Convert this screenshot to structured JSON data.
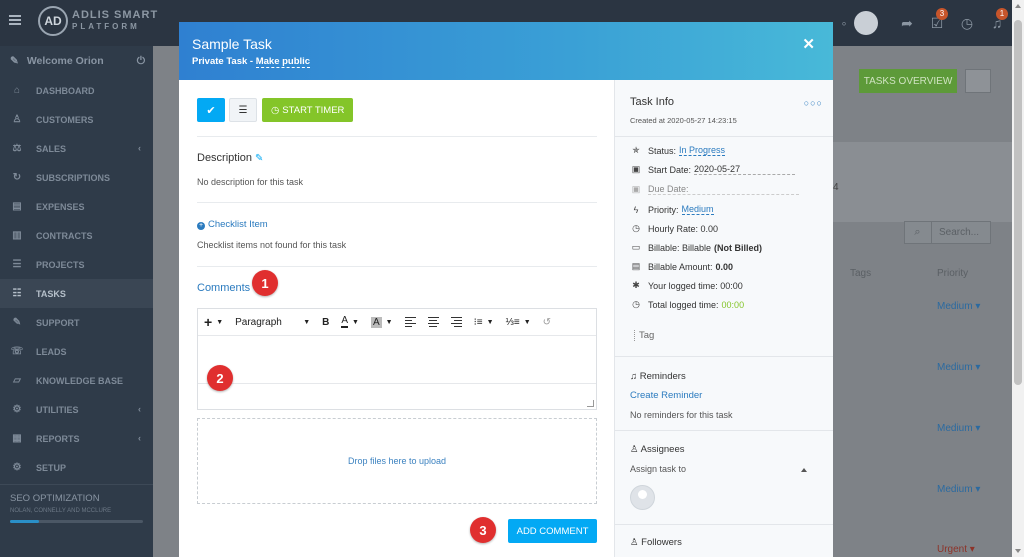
{
  "app": {
    "logo_mark": "AD",
    "logo_line1": "ADLIS SMART",
    "logo_line2": "PLATFORM",
    "badges": {
      "tasks": "3",
      "notifications": "1"
    }
  },
  "sidebar": {
    "welcome": "Welcome Orion",
    "items": [
      {
        "label": "DASHBOARD",
        "icon": "home-icon",
        "glyph": "⌂"
      },
      {
        "label": "CUSTOMERS",
        "icon": "user-icon",
        "glyph": "♙"
      },
      {
        "label": "SALES",
        "icon": "balance-icon",
        "glyph": "⚖",
        "chevron": true
      },
      {
        "label": "SUBSCRIPTIONS",
        "icon": "refresh-icon",
        "glyph": "↻"
      },
      {
        "label": "EXPENSES",
        "icon": "file-icon",
        "glyph": "▤"
      },
      {
        "label": "CONTRACTS",
        "icon": "document-icon",
        "glyph": "▥"
      },
      {
        "label": "PROJECTS",
        "icon": "bars-icon",
        "glyph": "☰"
      },
      {
        "label": "TASKS",
        "icon": "tasks-icon",
        "glyph": "☷",
        "active": true
      },
      {
        "label": "SUPPORT",
        "icon": "ticket-icon",
        "glyph": "✎"
      },
      {
        "label": "LEADS",
        "icon": "tty-icon",
        "glyph": "☏"
      },
      {
        "label": "KNOWLEDGE BASE",
        "icon": "folder-icon",
        "glyph": "▱"
      },
      {
        "label": "UTILITIES",
        "icon": "cogs-icon",
        "glyph": "⚙",
        "chevron": true
      },
      {
        "label": "REPORTS",
        "icon": "chart-icon",
        "glyph": "▦",
        "chevron": true
      },
      {
        "label": "SETUP",
        "icon": "gear-icon",
        "glyph": "⚙"
      }
    ],
    "project": {
      "name": "SEO OPTIMIZATION",
      "client": "NOLAN, CONNELLY AND MCCLURE",
      "progress": 0.22
    }
  },
  "background": {
    "tasks_overview": "TASKS OVERVIEW",
    "search_placeholder": "Search...",
    "col_tags": "Tags",
    "col_priority": "Priority",
    "priorities": [
      "Medium",
      "Medium",
      "Medium",
      "Medium"
    ],
    "last_priority": "Urgent",
    "partial_number": "4"
  },
  "modal": {
    "title": "Sample Task",
    "subtitle_prefix": "Private Task - ",
    "make_public": "Make public",
    "start_timer": "START TIMER",
    "description_title": "Description",
    "description_text": "No description for this task",
    "checklist_link": "Checklist Item",
    "checklist_empty": "Checklist items not found for this task",
    "comments_title": "Comments",
    "editor": {
      "paragraph": "Paragraph"
    },
    "dropzone": "Drop files here to upload",
    "add_comment": "ADD COMMENT",
    "markers": [
      "1",
      "2",
      "3"
    ]
  },
  "task_info": {
    "title": "Task Info",
    "created": "Created at 2020-05-27 14:23:15",
    "status_label": "Status:",
    "status_value": "In Progress",
    "start_label": "Start Date:",
    "start_value": "2020-05-27",
    "due_label": "Due Date:",
    "priority_label": "Priority:",
    "priority_value": "Medium",
    "hourly_label": "Hourly Rate: 0.00",
    "billable_label": "Billable: Billable",
    "billable_value": "(Not Billed)",
    "amount_label": "Billable Amount:",
    "amount_value": "0.00",
    "your_time": "Your logged time: 00:00",
    "total_label": "Total logged time:",
    "total_value": "00:00",
    "tag": "Tag",
    "reminders_title": "Reminders",
    "create_reminder": "Create Reminder",
    "no_reminders": "No reminders for this task",
    "assignees_title": "Assignees",
    "assign_placeholder": "Assign task to",
    "followers_title": "Followers"
  },
  "colors": {
    "accent": "#03a9f4",
    "green": "#84c529",
    "link": "#2b7bbf",
    "marker": "#e02f2f"
  }
}
